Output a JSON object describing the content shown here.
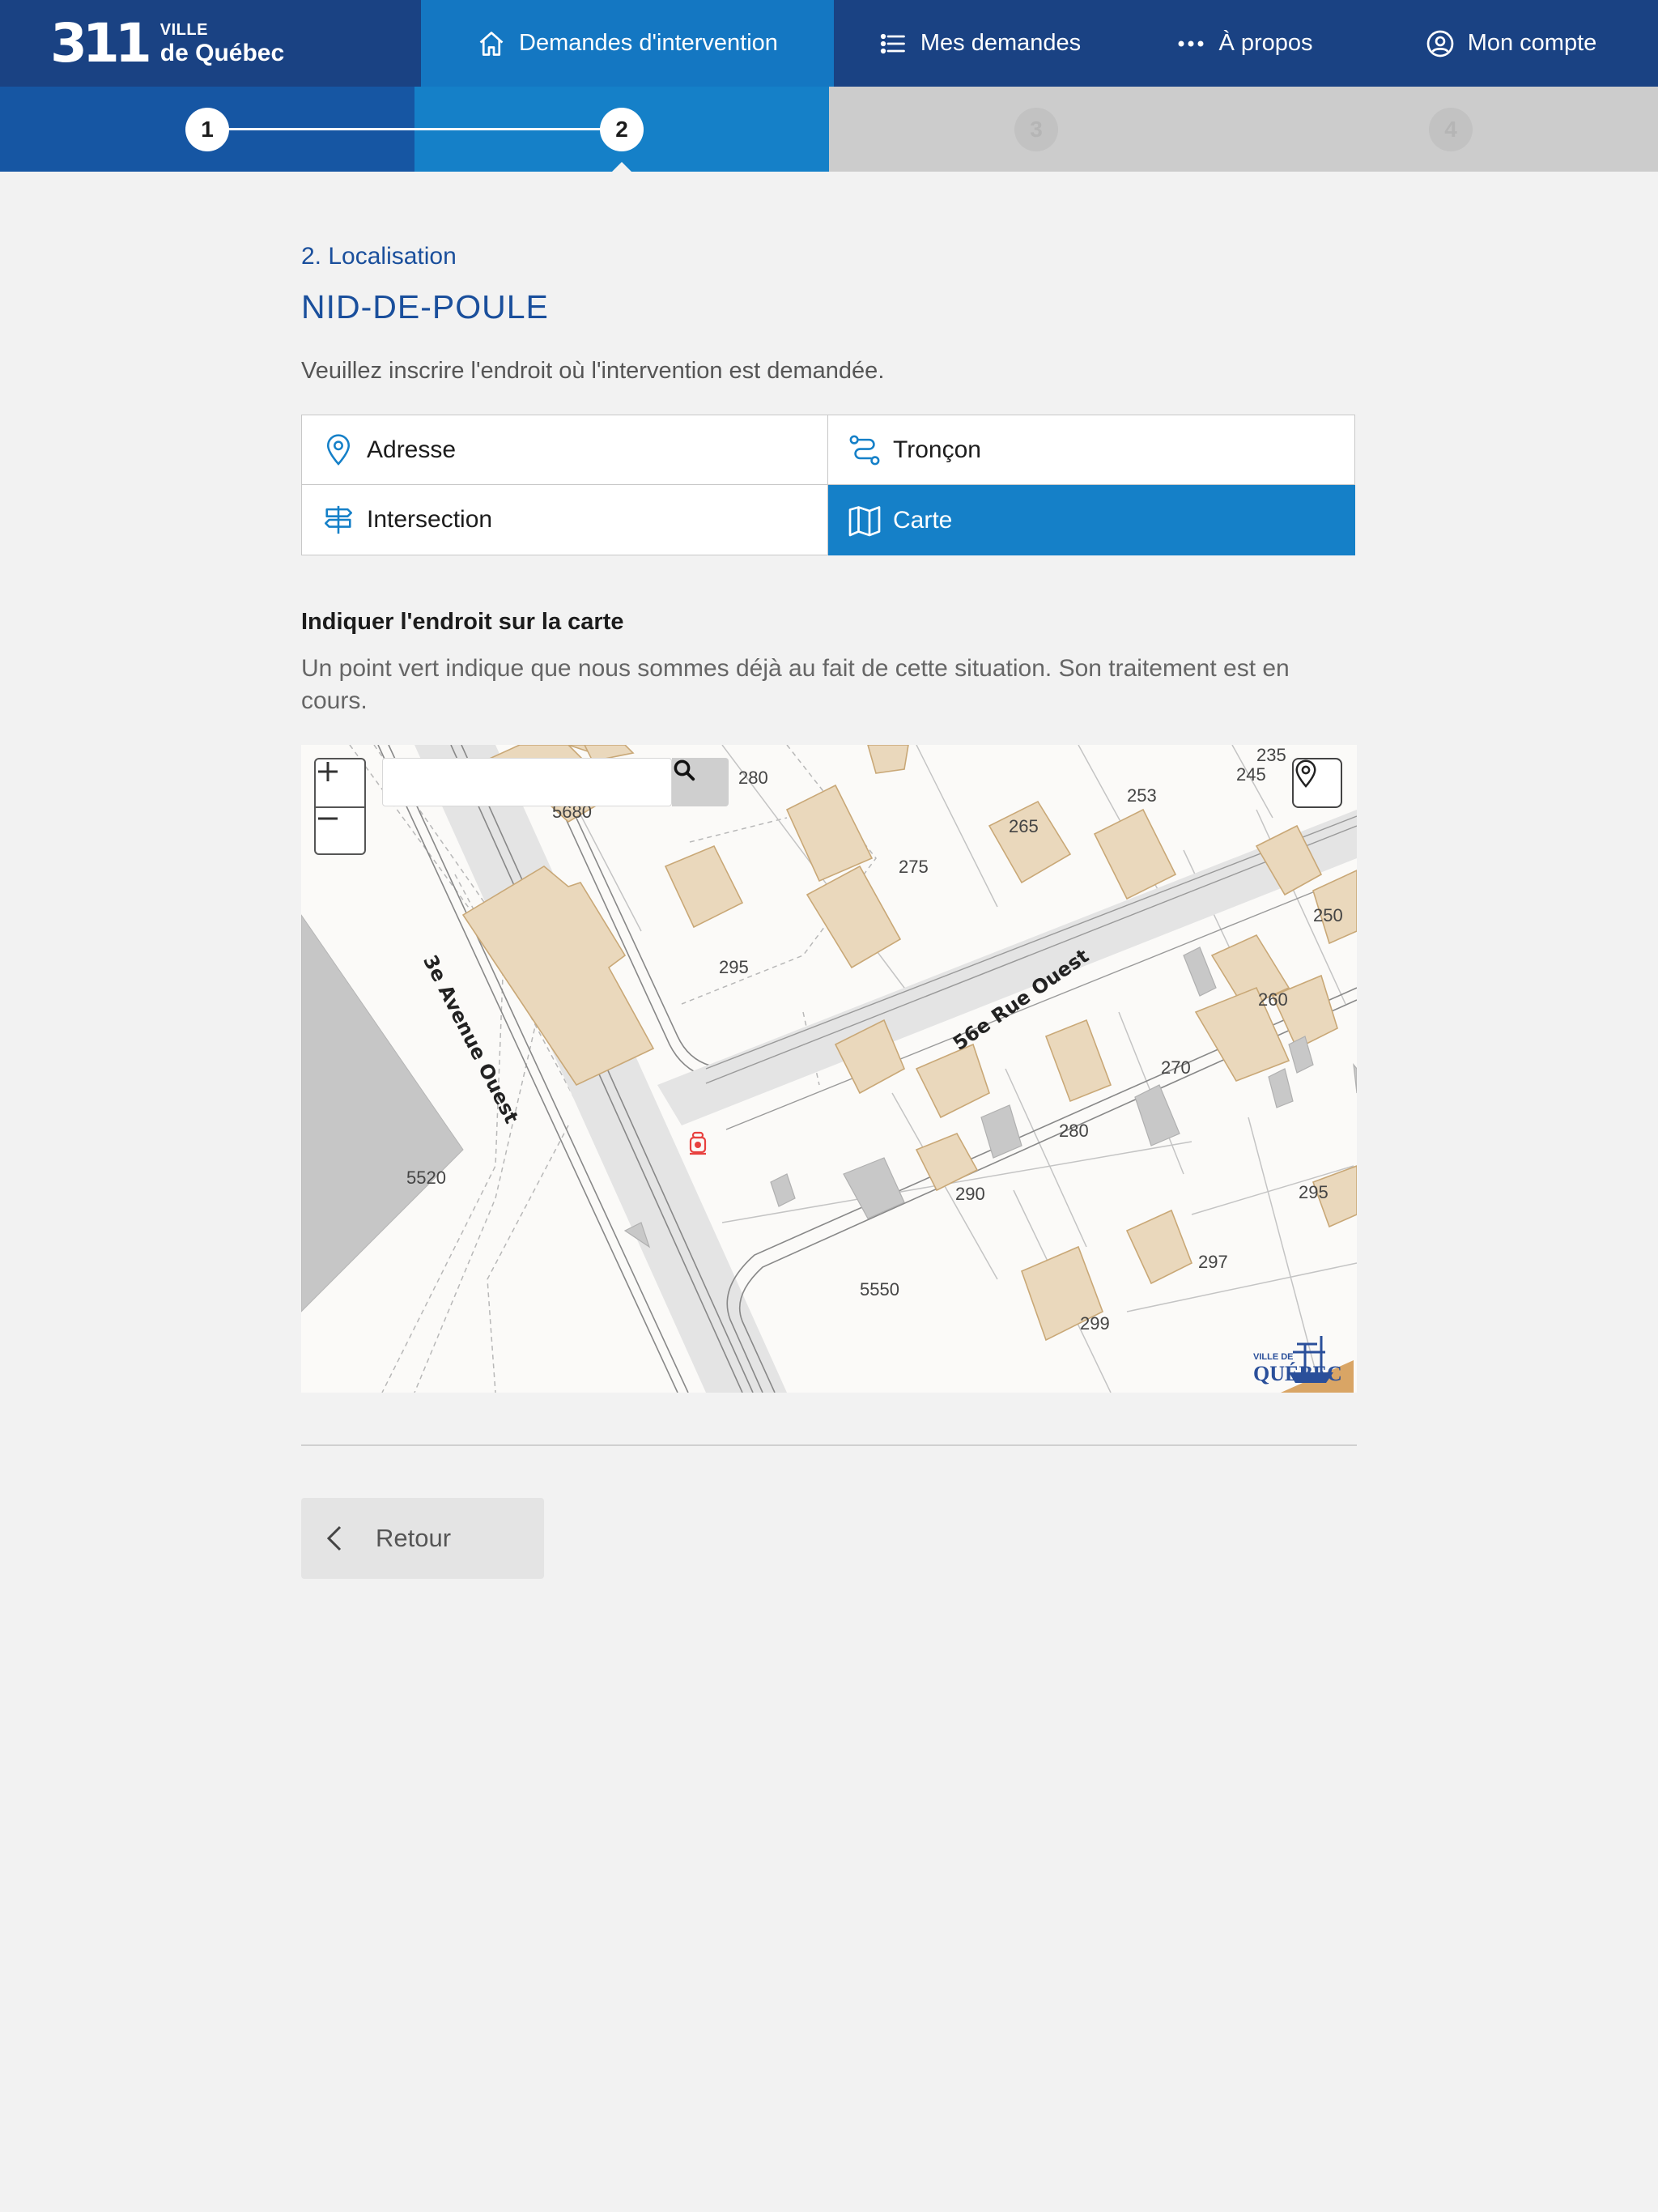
{
  "brand": {
    "number": "311",
    "ville": "VILLE",
    "city": "de Québec"
  },
  "nav": {
    "demandes": "Demandes d'intervention",
    "mes_demandes": "Mes demandes",
    "a_propos": "À propos",
    "mon_compte": "Mon compte"
  },
  "stepper": {
    "steps": [
      "1",
      "2",
      "3",
      "4"
    ],
    "current_step": 2
  },
  "page": {
    "section_label": "2. Localisation",
    "title": "NID-DE-POULE",
    "instruction": "Veuillez inscrire l'endroit où l'intervention est demandée."
  },
  "location_tabs": {
    "adresse": "Adresse",
    "troncon": "Tronçon",
    "intersection": "Intersection",
    "carte": "Carte",
    "selected": "Carte"
  },
  "map_section": {
    "heading": "Indiquer l'endroit sur la carte",
    "note": "Un point vert indique que nous sommes déjà au fait de cette situation. Son traitement est en cours."
  },
  "map": {
    "search_placeholder": "",
    "streets": [
      "3e Avenue Ouest",
      "56e Rue Ouest"
    ],
    "civic_numbers": [
      "280",
      "5680",
      "275",
      "265",
      "253",
      "245",
      "235",
      "250",
      "295",
      "260",
      "270",
      "280",
      "290",
      "5520",
      "5550",
      "299",
      "297",
      "295",
      "270"
    ],
    "watermark_small": "VILLE DE",
    "watermark": "QUÉBEC"
  },
  "actions": {
    "back": "Retour"
  },
  "colors": {
    "nav_bg": "#1a4283",
    "accent": "#1580c8",
    "step_done": "#1656a3",
    "title_blue": "#1a4f9c",
    "building": "#ead8bc",
    "page_bg": "#f2f2f2"
  }
}
